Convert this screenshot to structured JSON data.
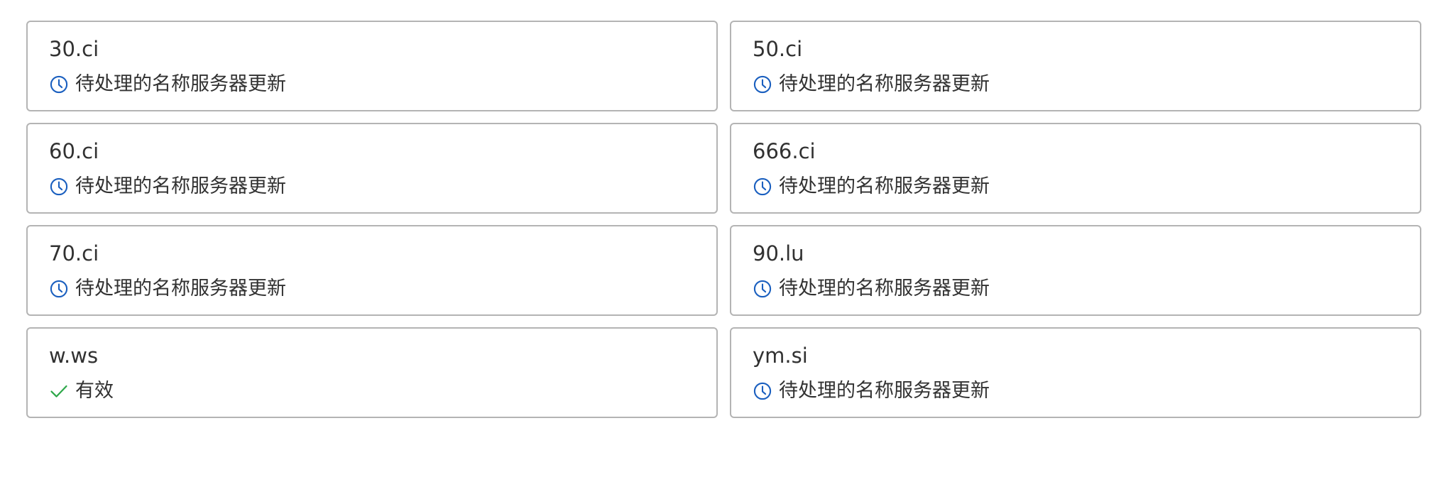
{
  "domains": [
    {
      "name": "30.ci",
      "status": "待处理的名称服务器更新",
      "icon": "clock-icon",
      "icon_color": "#1a5fbf"
    },
    {
      "name": "50.ci",
      "status": "待处理的名称服务器更新",
      "icon": "clock-icon",
      "icon_color": "#1a5fbf"
    },
    {
      "name": "60.ci",
      "status": "待处理的名称服务器更新",
      "icon": "clock-icon",
      "icon_color": "#1a5fbf"
    },
    {
      "name": "666.ci",
      "status": "待处理的名称服务器更新",
      "icon": "clock-icon",
      "icon_color": "#1a5fbf"
    },
    {
      "name": "70.ci",
      "status": "待处理的名称服务器更新",
      "icon": "clock-icon",
      "icon_color": "#1a5fbf"
    },
    {
      "name": "90.lu",
      "status": "待处理的名称服务器更新",
      "icon": "clock-icon",
      "icon_color": "#1a5fbf"
    },
    {
      "name": "w.ws",
      "status": "有效",
      "icon": "check-icon",
      "icon_color": "#2ea84a"
    },
    {
      "name": "ym.si",
      "status": "待处理的名称服务器更新",
      "icon": "clock-icon",
      "icon_color": "#1a5fbf"
    }
  ]
}
